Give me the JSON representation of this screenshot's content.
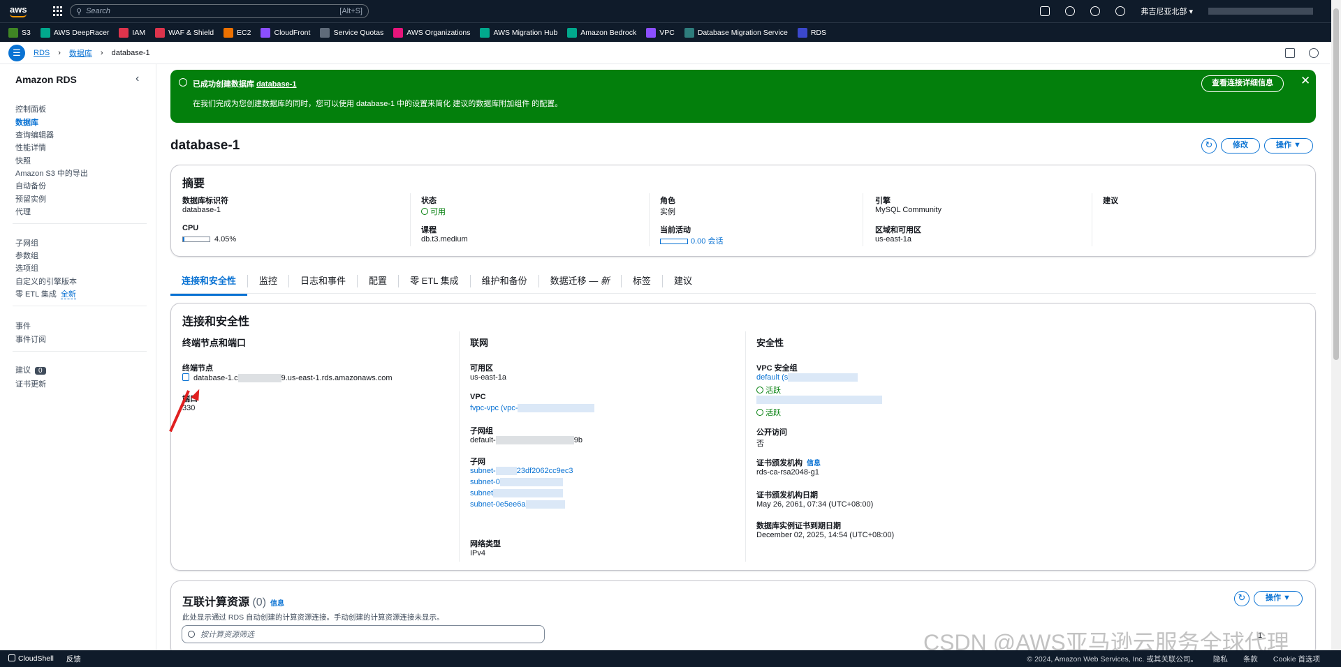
{
  "topnav": {
    "search_placeholder": "Search",
    "search_shortcut": "[Alt+S]",
    "region": "弗吉尼亚北部 ▾",
    "logo": "aws"
  },
  "favorites": [
    {
      "label": "S3",
      "color": "#3f8624"
    },
    {
      "label": "AWS DeepRacer",
      "color": "#01a88d"
    },
    {
      "label": "IAM",
      "color": "#dd344c"
    },
    {
      "label": "WAF & Shield",
      "color": "#dd344c"
    },
    {
      "label": "EC2",
      "color": "#ed7100"
    },
    {
      "label": "CloudFront",
      "color": "#8c4fff"
    },
    {
      "label": "Service Quotas",
      "color": "#5f6b7a"
    },
    {
      "label": "AWS Organizations",
      "color": "#e7157b"
    },
    {
      "label": "AWS Migration Hub",
      "color": "#01a88d"
    },
    {
      "label": "Amazon Bedrock",
      "color": "#01a88d"
    },
    {
      "label": "VPC",
      "color": "#8c4fff"
    },
    {
      "label": "Database Migration Service",
      "color": "#2e7d7d"
    },
    {
      "label": "RDS",
      "color": "#3b48cc"
    }
  ],
  "breadcrumb": [
    "RDS",
    "数据库",
    "database-1"
  ],
  "sidebar": {
    "title": "Amazon RDS",
    "group1": [
      "控制面板",
      "数据库",
      "查询编辑器",
      "性能详情",
      "快照",
      "Amazon S3 中的导出",
      "自动备份",
      "预留实例",
      "代理"
    ],
    "group2": [
      "子网组",
      "参数组",
      "选项组",
      "自定义的引擎版本",
      "零 ETL 集成"
    ],
    "new_label": "全新",
    "group3": [
      "事件",
      "事件订阅"
    ],
    "group4": [
      "建议",
      "证书更新"
    ],
    "recommend_count": "0"
  },
  "flash": {
    "title_prefix": "已成功创建数据库",
    "db_name": "database-1",
    "message": "在我们完成为您创建数据库的同时，您可以使用 database-1 中的设置来简化 建议的数据库附加组件 的配置。",
    "button": "查看连接详细信息"
  },
  "page": {
    "title": "database-1",
    "modify": "修改",
    "actions": "操作 ▼"
  },
  "summary": {
    "heading": "摘要",
    "db_id_label": "数据库标识符",
    "db_id": "database-1",
    "cpu_label": "CPU",
    "cpu_value": "4.05%",
    "cpu_fraction": 0.0405,
    "status_label": "状态",
    "status": "可用",
    "class_label": "课程",
    "class": "db.t3.medium",
    "role_label": "角色",
    "role": "实例",
    "activity_label": "当前活动",
    "activity": "0.00 会话",
    "engine_label": "引擎",
    "engine": "MySQL Community",
    "az_label": "区域和可用区",
    "az": "us-east-1a",
    "recommend_label": "建议"
  },
  "tabs": [
    "连接和安全性",
    "监控",
    "日志和事件",
    "配置",
    "零 ETL 集成",
    "维护和备份",
    "数据迁移 — ",
    "标签",
    "建议"
  ],
  "tab_new": "新",
  "conn": {
    "heading": "连接和安全性",
    "col1": "终端节点和端口",
    "endpoint_label": "终端节点",
    "endpoint_a": "database-1.c",
    "endpoint_b": "9.us-east-1.rds.amazonaws.com",
    "port_label": "端口",
    "port": "330",
    "col2": "联网",
    "az_label": "可用区",
    "az": "us-east-1a",
    "vpc_label": "VPC",
    "vpc": "fvpc-vpc (vpc-",
    "subnet_group_label": "子网组",
    "subnet_group_a": "default-",
    "subnet_group_b": "9b",
    "subnets_label": "子网",
    "subnets": [
      "subnet-",
      "subnet-0",
      "subnet",
      "subnet-0e5ee6a"
    ],
    "subnet0_tail": "23df2062cc9ec3",
    "net_type_label": "网络类型",
    "net_type": "IPv4",
    "col3": "安全性",
    "sg_label": "VPC 安全组",
    "sg1": "default (s",
    "sg_status": "活跃",
    "public_label": "公开访问",
    "public": "否",
    "ca_label": "证书颁发机构",
    "ca_info": "信息",
    "ca": "rds-ca-rsa2048-g1",
    "ca_date_label": "证书颁发机构日期",
    "ca_date": "May 26, 2061, 07:34 (UTC+08:00)",
    "cert_exp_label": "数据库实例证书到期日期",
    "cert_exp": "December 02, 2025, 14:54 (UTC+08:00)"
  },
  "compute": {
    "heading": "互联计算资源",
    "count": "(0)",
    "info": "信息",
    "desc": "此处显示通过 RDS 自动创建的计算资源连接。手动创建的计算资源连接未显示。",
    "filter_placeholder": "按计算资源筛选",
    "actions": "操作 ▼",
    "page": "1"
  },
  "footer": {
    "cloudshell": "CloudShell",
    "feedback": "反馈",
    "copyright": "© 2024, Amazon Web Services, Inc. 或其关联公司。",
    "privacy": "隐私",
    "terms": "条款",
    "cookie": "Cookie 首选项"
  },
  "watermark": "CSDN @AWS亚马逊云服务全球代理"
}
